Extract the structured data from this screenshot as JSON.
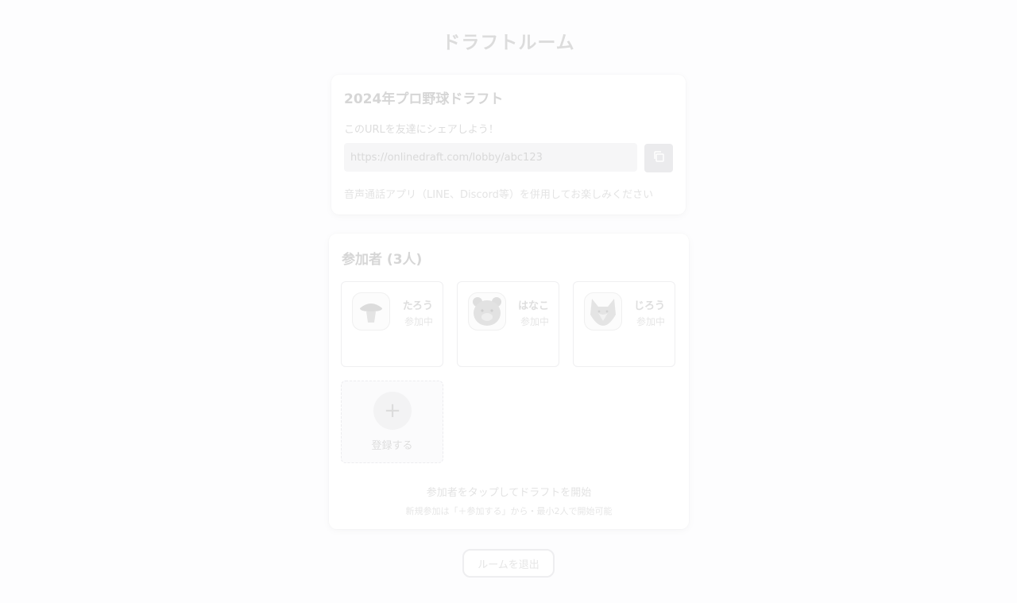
{
  "page": {
    "title": "ドラフトルーム"
  },
  "room": {
    "title": "2024年プロ野球ドラフト",
    "share_text": "このURLを友達にシェアしよう！",
    "url": "https://onlinedraft.com/lobby/abc123",
    "copy_icon": "copy-icon",
    "voice_text": "音声通話アプリ（LINE、Discord等）を併用してお楽しみください"
  },
  "members": {
    "title": "参加者 (3人)",
    "list": [
      {
        "name": "たろう",
        "status": "参加中",
        "avatar": "mushroom-icon"
      },
      {
        "name": "はなこ",
        "status": "参加中",
        "avatar": "bear-icon"
      },
      {
        "name": "じろう",
        "status": "参加中",
        "avatar": "wolf-icon"
      }
    ],
    "register_label": "登録する",
    "register_icon": "plus-icon",
    "hint_main": "参加者をタップしてドラフトを開始",
    "hint_sub": "新規参加は「＋参加する」から・最小2人で開始可能"
  },
  "leave_button": "ルームを退出",
  "colors": {
    "background": "#fdfdfe",
    "card": "#ffffff",
    "muted_text": "#dedede"
  }
}
